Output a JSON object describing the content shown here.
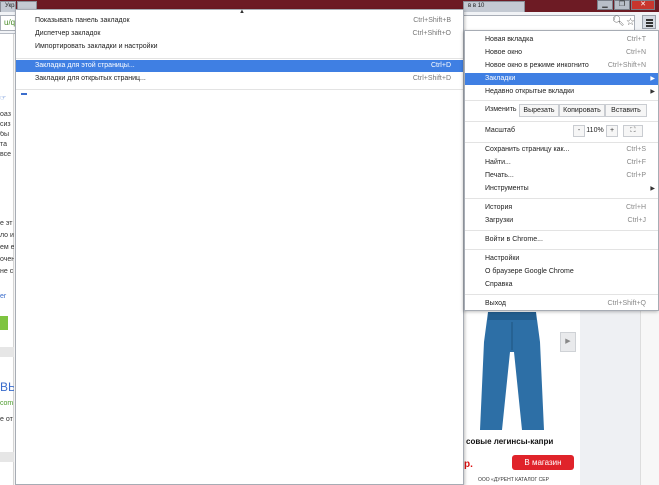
{
  "browser": {
    "tabs": [
      "Укра",
      "",
      "в в 10"
    ],
    "url": "u/q",
    "window_buttons": [
      "▁",
      "❐",
      "✕"
    ]
  },
  "page": {
    "side_lines": [
      "☞",
      "оаз",
      "сиз",
      "бы",
      "та",
      "все",
      "е эт",
      "ло и",
      "ем е",
      "очен",
      "не с",
      "er"
    ],
    "side_bottom": [
      "ВЫ",
      "com",
      "е от"
    ]
  },
  "ad": {
    "title": "совые легинсы-капри",
    "price": "р.",
    "button_label": "В магазин",
    "footer": "ООО «ДУРЕНТ КАТАЛОГ СЕР",
    "arrow": "▶"
  },
  "bookmarks_menu": {
    "items": [
      {
        "label": "Показывать панель закладок",
        "shortcut": "Ctrl+Shift+B"
      },
      {
        "label": "Диспетчер закладок",
        "shortcut": "Ctrl+Shift+O"
      },
      {
        "label": "Импортировать закладки и настройки",
        "shortcut": ""
      },
      {
        "label": "Закладка для этой страницы...",
        "shortcut": "Ctrl+D"
      },
      {
        "label": "Закладки для открытых страниц...",
        "shortcut": "Ctrl+Shift+D"
      }
    ]
  },
  "chrome_menu": {
    "top_items": [
      {
        "label": "Новая вкладка",
        "shortcut": "Ctrl+T"
      },
      {
        "label": "Новое окно",
        "shortcut": "Ctrl+N"
      },
      {
        "label": "Новое окно в режиме инкогнито",
        "shortcut": "Ctrl+Shift+N"
      },
      {
        "label": "Закладки",
        "shortcut": ""
      },
      {
        "label": "Недавно открытые вкладки",
        "shortcut": ""
      }
    ],
    "edit": {
      "label": "Изменить",
      "cut": "Вырезать",
      "copy": "Копировать",
      "paste": "Вставить"
    },
    "zoom": {
      "label": "Масштаб",
      "minus": "-",
      "value": "110%",
      "plus": "+",
      "fullscreen": "⛶"
    },
    "middle_items": [
      {
        "label": "Сохранить страницу как...",
        "shortcut": "Ctrl+S"
      },
      {
        "label": "Найти...",
        "shortcut": "Ctrl+F"
      },
      {
        "label": "Печать...",
        "shortcut": "Ctrl+P"
      },
      {
        "label": "Инструменты",
        "shortcut": ""
      }
    ],
    "history_items": [
      {
        "label": "История",
        "shortcut": "Ctrl+H"
      },
      {
        "label": "Загрузки",
        "shortcut": "Ctrl+J"
      }
    ],
    "signin": "Войти в Chrome...",
    "settings_items": [
      {
        "label": "Настройки"
      },
      {
        "label": "О браузере Google Chrome"
      },
      {
        "label": "Справка"
      }
    ],
    "exit": {
      "label": "Выход",
      "shortcut": "Ctrl+Shift+Q"
    }
  },
  "colors": {
    "highlight": "#3f7fe3",
    "ad_button": "#e0232a",
    "tabstrip": "#6d1b24"
  }
}
